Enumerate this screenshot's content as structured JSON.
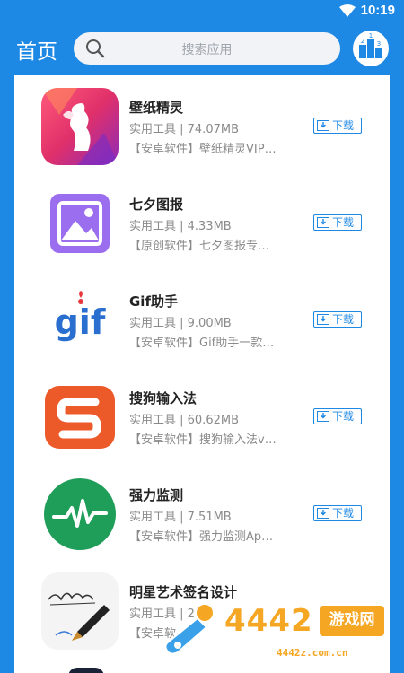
{
  "status_bar": {
    "time": "10:19"
  },
  "header": {
    "title": "首页",
    "search_placeholder": "搜索应用",
    "rank_numbers": [
      "1",
      "2",
      "3"
    ]
  },
  "download_label": "下载",
  "apps": [
    {
      "name": "壁纸精灵",
      "meta": "实用工具 | 74.07MB",
      "desc": "【安卓软件】壁纸精灵VIP…",
      "icon": "fairy-wallpaper-icon"
    },
    {
      "name": "七夕图报",
      "meta": "实用工具 | 4.33MB",
      "desc": "【原创软件】七夕图报专…",
      "icon": "image-icon"
    },
    {
      "name": "Gif助手",
      "meta": "实用工具 | 9.00MB",
      "desc": "【安卓软件】Gif助手一款…",
      "icon": "gif-icon"
    },
    {
      "name": "搜狗输入法",
      "meta": "实用工具 | 60.62MB",
      "desc": "【安卓软件】搜狗输入法v…",
      "icon": "sogou-s-icon"
    },
    {
      "name": "强力监测",
      "meta": "实用工具 | 7.51MB",
      "desc": "【安卓软件】强力监测Ap…",
      "icon": "pulse-icon"
    },
    {
      "name": "明星艺术签名设计",
      "meta": "实用工具 | 29",
      "desc": "【安卓软",
      "icon": "signature-pen-icon"
    }
  ],
  "watermark": {
    "number": "4442",
    "brand": "游戏网",
    "url": "4442z.com.cn"
  },
  "colors": {
    "primary": "#1e88e5",
    "watermark": "#f5a623"
  }
}
